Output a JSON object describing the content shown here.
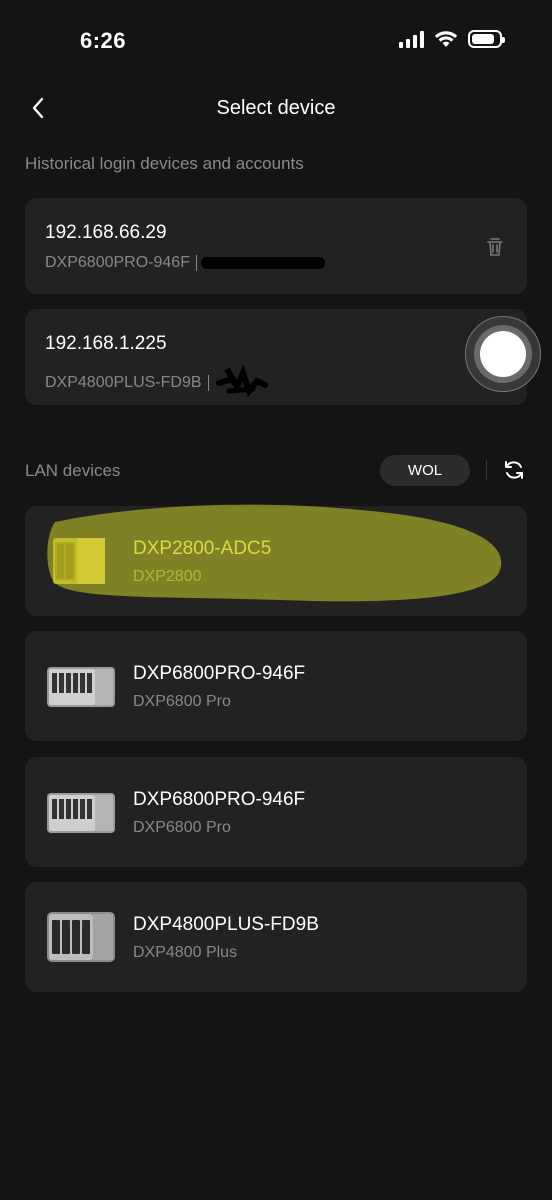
{
  "status_bar": {
    "time": "6:26",
    "battery_level": 0.85
  },
  "nav": {
    "title": "Select device"
  },
  "history": {
    "label": "Historical login devices and accounts",
    "items": [
      {
        "ip": "192.168.66.29",
        "device": "DXP6800PRO-946F"
      },
      {
        "ip": "192.168.1.225",
        "device": "DXP4800PLUS-FD9B"
      }
    ]
  },
  "lan": {
    "label": "LAN devices",
    "wol_label": "WOL",
    "devices": [
      {
        "name": "DXP2800-ADC5",
        "model": "DXP2800",
        "image": "nas-2bay-gold"
      },
      {
        "name": "DXP6800PRO-946F",
        "model": "DXP6800 Pro",
        "image": "nas-6bay-silver"
      },
      {
        "name": "DXP6800PRO-946F",
        "model": "DXP6800 Pro",
        "image": "nas-6bay-silver"
      },
      {
        "name": "DXP4800PLUS-FD9B",
        "model": "DXP4800 Plus",
        "image": "nas-4bay-grey"
      }
    ]
  },
  "colors": {
    "background": "#141414",
    "card": "#222222",
    "highlight": "#e8e86a"
  }
}
